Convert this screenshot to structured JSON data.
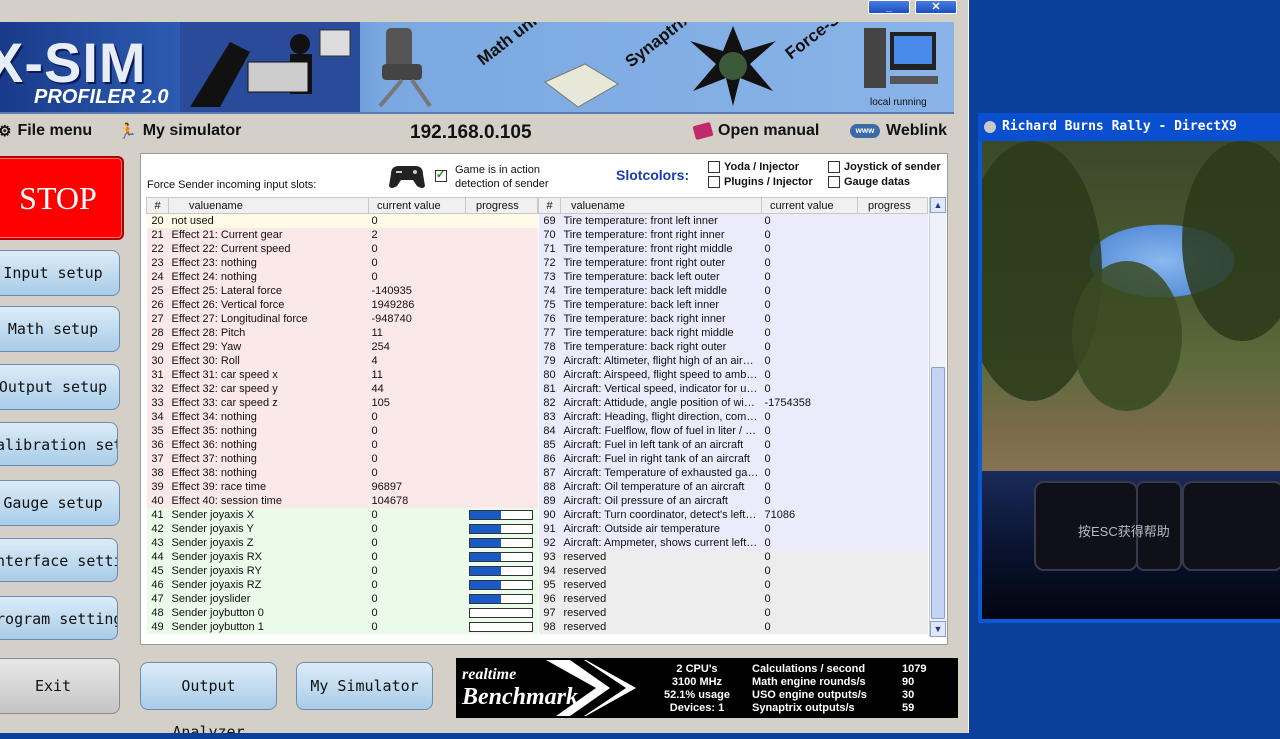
{
  "app": {
    "banner": {
      "title": "X-SIM",
      "subtitle": "PROFILER 2.0",
      "words": [
        "Math unit",
        "Synaptrix",
        "Force-Sender"
      ],
      "local_running": "local running"
    },
    "menu": {
      "file": "File menu",
      "simulator": "My simulator",
      "ip": "192.168.0.105",
      "manual": "Open manual",
      "weblink": "Weblink"
    },
    "sidebar": {
      "stop": "STOP",
      "buttons": [
        "Input setup",
        "Math setup",
        "Output setup",
        "Calibration setup",
        "Gauge setup",
        "Interface settings",
        "Program settings",
        "Exit"
      ]
    },
    "panel": {
      "incoming_label": "Force Sender incoming input slots:",
      "game_action": "Game is in action",
      "detection": "detection of sender",
      "slotcolors": "Slotcolors:",
      "legend": [
        "Yoda / Injector",
        "Plugins / Injector",
        "Joystick of sender",
        "Gauge datas"
      ],
      "headers": [
        "#",
        "valuename",
        "current value",
        "progress"
      ],
      "left_rows": [
        [
          "20",
          "not used",
          "0"
        ],
        [
          "21",
          "Effect 21: Current gear",
          "2"
        ],
        [
          "22",
          "Effect 22: Current speed",
          "0"
        ],
        [
          "23",
          "Effect 23: nothing",
          "0"
        ],
        [
          "24",
          "Effect 24: nothing",
          "0"
        ],
        [
          "25",
          "Effect 25: Lateral force",
          "-140935"
        ],
        [
          "26",
          "Effect 26: Vertical force",
          "1949286"
        ],
        [
          "27",
          "Effect 27: Longitudinal force",
          "-948740"
        ],
        [
          "28",
          "Effect 28: Pitch",
          "11"
        ],
        [
          "29",
          "Effect 29: Yaw",
          "254"
        ],
        [
          "30",
          "Effect 30: Roll",
          "4"
        ],
        [
          "31",
          "Effect 31: car speed x",
          "11"
        ],
        [
          "32",
          "Effect 32: car speed y",
          "44"
        ],
        [
          "33",
          "Effect 33: car speed z",
          "105"
        ],
        [
          "34",
          "Effect 34: nothing",
          "0"
        ],
        [
          "35",
          "Effect 35: nothing",
          "0"
        ],
        [
          "36",
          "Effect 36: nothing",
          "0"
        ],
        [
          "37",
          "Effect 37: nothing",
          "0"
        ],
        [
          "38",
          "Effect 38: nothing",
          "0"
        ],
        [
          "39",
          "Effect 39: race time",
          "96897"
        ],
        [
          "40",
          "Effect 40: session time",
          "104678"
        ],
        [
          "41",
          "Sender joyaxis X",
          "0"
        ],
        [
          "42",
          "Sender joyaxis Y",
          "0"
        ],
        [
          "43",
          "Sender joyaxis Z",
          "0"
        ],
        [
          "44",
          "Sender joyaxis RX",
          "0"
        ],
        [
          "45",
          "Sender joyaxis RY",
          "0"
        ],
        [
          "46",
          "Sender joyaxis RZ",
          "0"
        ],
        [
          "47",
          "Sender joyslider",
          "0"
        ],
        [
          "48",
          "Sender joybutton 0",
          "0"
        ],
        [
          "49",
          "Sender joybutton 1",
          "0"
        ]
      ],
      "left_progress": [
        null,
        null,
        null,
        null,
        null,
        null,
        null,
        null,
        null,
        null,
        null,
        null,
        null,
        null,
        null,
        null,
        null,
        null,
        null,
        null,
        null,
        0.5,
        0.5,
        0.5,
        0.5,
        0.5,
        0.5,
        0.5,
        0,
        0
      ],
      "right_rows": [
        [
          "69",
          "Tire temperature: front left inner",
          "0"
        ],
        [
          "70",
          "Tire temperature: front right inner",
          "0"
        ],
        [
          "71",
          "Tire temperature: front right middle",
          "0"
        ],
        [
          "72",
          "Tire temperature: front right outer",
          "0"
        ],
        [
          "73",
          "Tire temperature: back left outer",
          "0"
        ],
        [
          "74",
          "Tire temperature: back left middle",
          "0"
        ],
        [
          "75",
          "Tire temperature: back left inner",
          "0"
        ],
        [
          "76",
          "Tire temperature: back right inner",
          "0"
        ],
        [
          "77",
          "Tire temperature: back right middle",
          "0"
        ],
        [
          "78",
          "Tire temperature: back right outer",
          "0"
        ],
        [
          "79",
          "Aircraft: Altimeter, flight high of an aircraft",
          "0"
        ],
        [
          "80",
          "Aircraft: Airspeed, flight speed to ambien...",
          "0"
        ],
        [
          "81",
          "Aircraft: Vertical speed, indicator for up/...",
          "0"
        ],
        [
          "82",
          "Aircraft: Attidude, angle position of wing...",
          "-1754358"
        ],
        [
          "83",
          "Aircraft: Heading, flight direction, compass",
          "0"
        ],
        [
          "84",
          "Aircraft: Fuelflow, flow of fuel in liter / mi...",
          "0"
        ],
        [
          "85",
          "Aircraft: Fuel in left tank of an aircraft",
          "0"
        ],
        [
          "86",
          "Aircraft: Fuel in right tank of an aircraft",
          "0"
        ],
        [
          "87",
          "Aircraft: Temperature of exhausted gas ...",
          "0"
        ],
        [
          "88",
          "Aircraft: Oil temperature of an aircraft",
          "0"
        ],
        [
          "89",
          "Aircraft: Oil pressure of an aircraft",
          "0"
        ],
        [
          "90",
          "Aircraft: Turn coordinator, detect's left ri...",
          "71086"
        ],
        [
          "91",
          "Aircraft: Outside air temperature",
          "0"
        ],
        [
          "92",
          "Aircraft: Ampmeter, shows current left p...",
          "0"
        ],
        [
          "93",
          "reserved",
          "0"
        ],
        [
          "94",
          "reserved",
          "0"
        ],
        [
          "95",
          "reserved",
          "0"
        ],
        [
          "96",
          "reserved",
          "0"
        ],
        [
          "97",
          "reserved",
          "0"
        ],
        [
          "98",
          "reserved",
          "0"
        ]
      ]
    },
    "bottom_buttons": [
      "Output Analyzer",
      "My Simulator"
    ],
    "benchmark": {
      "logo_top": "realtime",
      "logo_bottom": "Benchmark",
      "col1": [
        "2 CPU's",
        "3100 MHz",
        "52.1% usage",
        "Devices: 1"
      ],
      "col2": [
        "Calculations / second",
        "Math engine rounds/s",
        "USO engine outputs/s",
        "Synaptrix outputs/s"
      ],
      "col3": [
        "1079",
        "90",
        "30",
        "59"
      ]
    }
  },
  "game_window": {
    "title": "Richard Burns Rally - DirectX9",
    "overlay_text": "按ESC获得帮助"
  },
  "colors": {
    "row_yellow": "#fffbe8",
    "row_pink": "#fbe8e8",
    "row_green": "#eafbea",
    "row_lavender": "#ecebfb",
    "row_gray": "#ededed",
    "bar_fill": "#1a5ac8"
  }
}
